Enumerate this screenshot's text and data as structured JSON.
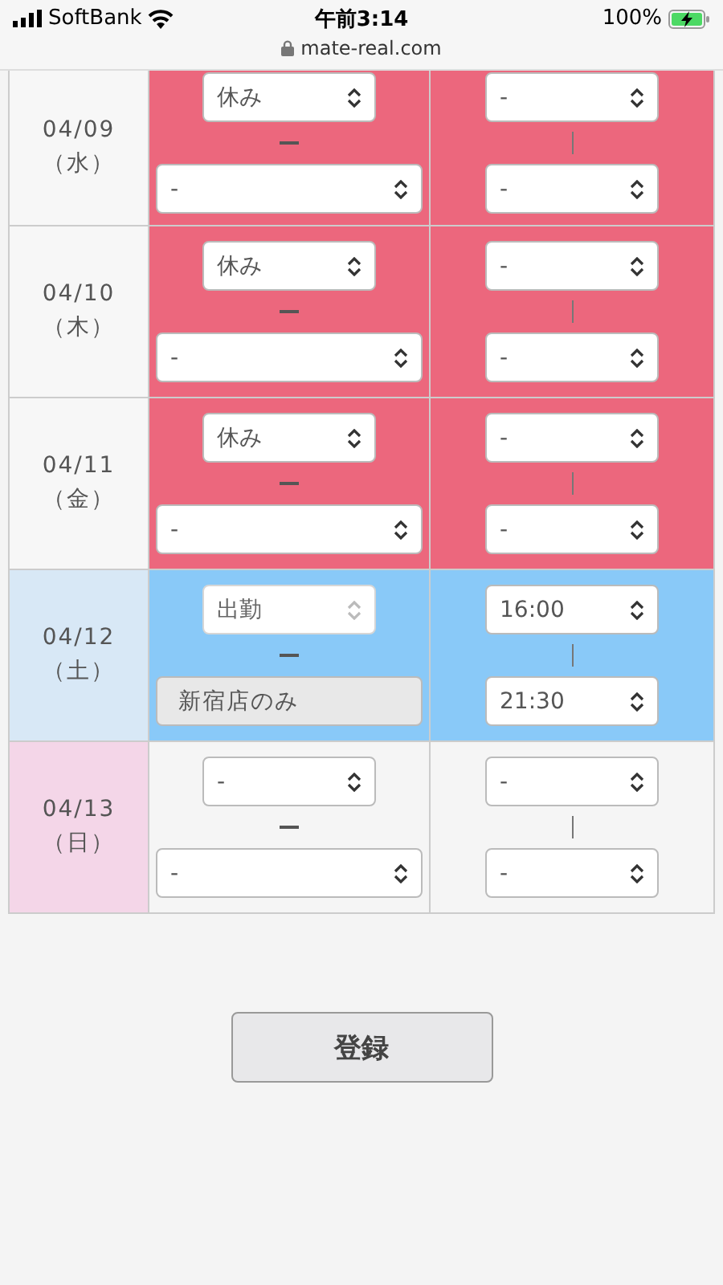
{
  "status_bar": {
    "carrier": "SoftBank",
    "time": "午前3:14",
    "battery": "100%",
    "charging": true,
    "url": "mate-real.com"
  },
  "rows": [
    {
      "date": "04/09",
      "weekday": "（水）",
      "saturday": false,
      "sunday": false,
      "kind": "off",
      "shift": {
        "value": "休み",
        "disabled": false
      },
      "store": {
        "value": "-",
        "disabled": false
      },
      "start": "-",
      "end": "-"
    },
    {
      "date": "04/10",
      "weekday": "（木）",
      "saturday": false,
      "sunday": false,
      "kind": "off",
      "shift": {
        "value": "休み",
        "disabled": false
      },
      "store": {
        "value": "-",
        "disabled": false
      },
      "start": "-",
      "end": "-"
    },
    {
      "date": "04/11",
      "weekday": "（金）",
      "saturday": false,
      "sunday": false,
      "kind": "off",
      "shift": {
        "value": "休み",
        "disabled": false
      },
      "store": {
        "value": "-",
        "disabled": false
      },
      "start": "-",
      "end": "-"
    },
    {
      "date": "04/12",
      "weekday": "（土）",
      "saturday": true,
      "sunday": false,
      "kind": "work",
      "shift": {
        "value": "出勤",
        "disabled": true
      },
      "store": {
        "value": "新宿店のみ",
        "disabled": true
      },
      "start": "16:00",
      "end": "21:30"
    },
    {
      "date": "04/13",
      "weekday": "（日）",
      "saturday": false,
      "sunday": true,
      "kind": "none",
      "shift": {
        "value": "-",
        "disabled": false
      },
      "store": {
        "value": "-",
        "disabled": false
      },
      "start": "-",
      "end": "-"
    }
  ],
  "submit_button": "登録"
}
